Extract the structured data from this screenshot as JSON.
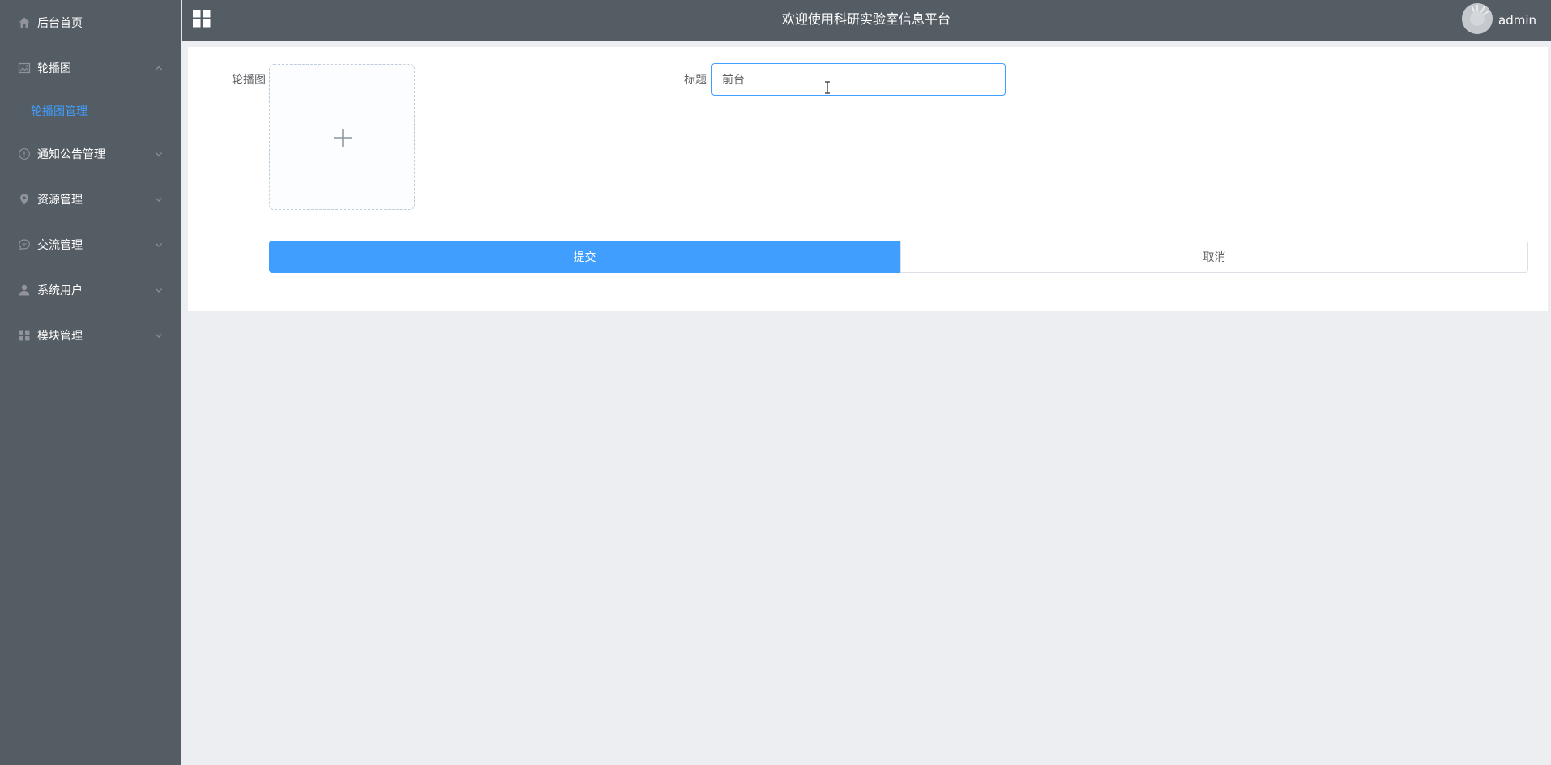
{
  "sidebar": {
    "items": [
      {
        "label": "后台首页",
        "icon": "home-icon"
      },
      {
        "label": "轮播图",
        "icon": "picture-icon",
        "expanded": true,
        "children": [
          {
            "label": "轮播图管理",
            "active": true
          }
        ]
      },
      {
        "label": "通知公告管理",
        "icon": "info-icon"
      },
      {
        "label": "资源管理",
        "icon": "location-icon"
      },
      {
        "label": "交流管理",
        "icon": "chat-icon"
      },
      {
        "label": "系统用户",
        "icon": "user-icon"
      },
      {
        "label": "模块管理",
        "icon": "menu-grid-icon"
      }
    ]
  },
  "header": {
    "title": "欢迎使用科研实验室信息平台",
    "username": "admin"
  },
  "form": {
    "carousel_label": "轮播图",
    "title_label": "标题",
    "title_value": "前台",
    "submit_label": "提交",
    "cancel_label": "取消"
  },
  "colors": {
    "sidebar_bg": "#545c64",
    "active_text": "#409eff",
    "primary": "#409eff",
    "page_bg": "#edeef2"
  }
}
